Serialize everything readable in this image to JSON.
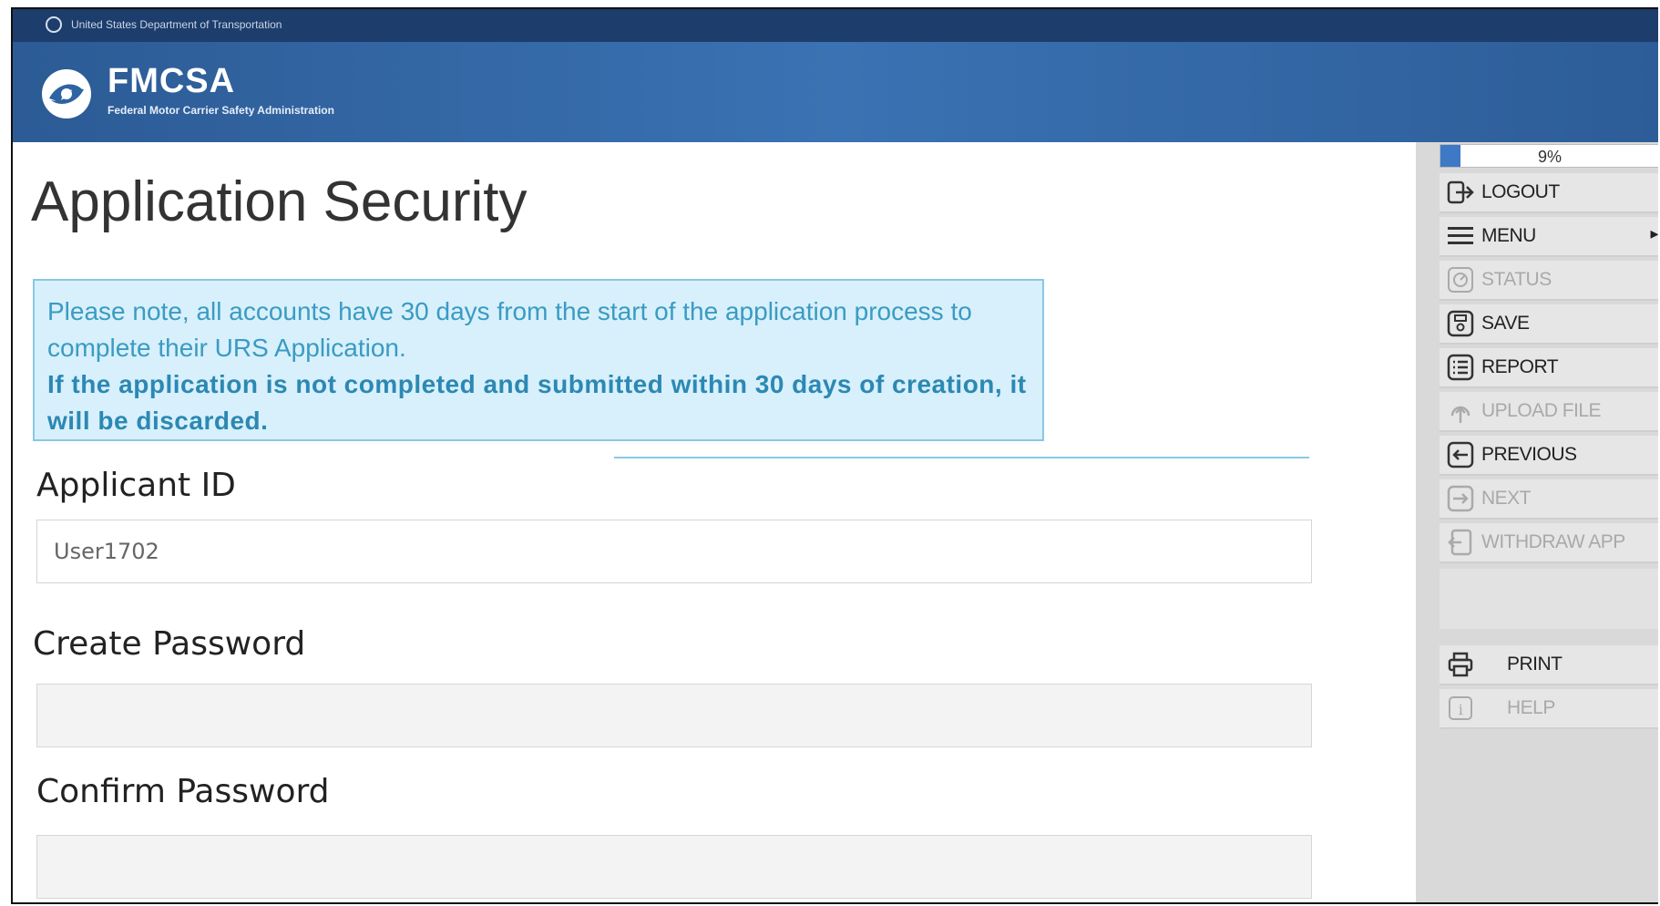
{
  "agency_bar": {
    "text": "United States Department of Transportation"
  },
  "header": {
    "brand": "FMCSA",
    "subtitle": "Federal Motor Carrier Safety Administration",
    "colors": {
      "bar": "#1d3d6c",
      "header": "#3a72b3"
    }
  },
  "page": {
    "title": "Application Security",
    "notice_line1": "Please note, all accounts have 30 days from the start of the application process to complete their URS Application.",
    "notice_line2": "If the application is not completed and submitted within 30 days of creation, it will be discarded."
  },
  "form": {
    "applicant_id": {
      "label": "Applicant ID",
      "value": "User1702"
    },
    "create_password": {
      "label": "Create Password",
      "value": ""
    },
    "confirm_password": {
      "label": "Confirm Password",
      "value": ""
    }
  },
  "sidebar": {
    "progress": {
      "percent": 9,
      "label": "9%"
    },
    "buttons": [
      {
        "label": "LOGOUT",
        "icon": "logout-icon",
        "enabled": true
      },
      {
        "label": "MENU",
        "icon": "menu-icon",
        "enabled": true
      },
      {
        "label": "STATUS",
        "icon": "status-icon",
        "enabled": false
      },
      {
        "label": "SAVE",
        "icon": "save-icon",
        "enabled": true
      },
      {
        "label": "REPORT",
        "icon": "report-icon",
        "enabled": true
      },
      {
        "label": "UPLOAD FILE",
        "icon": "upload-icon",
        "enabled": false
      },
      {
        "label": "PREVIOUS",
        "icon": "arrow-left-icon",
        "enabled": true
      },
      {
        "label": "NEXT",
        "icon": "arrow-right-icon",
        "enabled": false
      },
      {
        "label": "WITHDRAW APP",
        "icon": "withdraw-icon",
        "enabled": false
      }
    ],
    "print": {
      "label": "PRINT",
      "icon": "printer-icon",
      "enabled": true
    },
    "help": {
      "label": "HELP",
      "icon": "info-icon",
      "enabled": false
    }
  }
}
